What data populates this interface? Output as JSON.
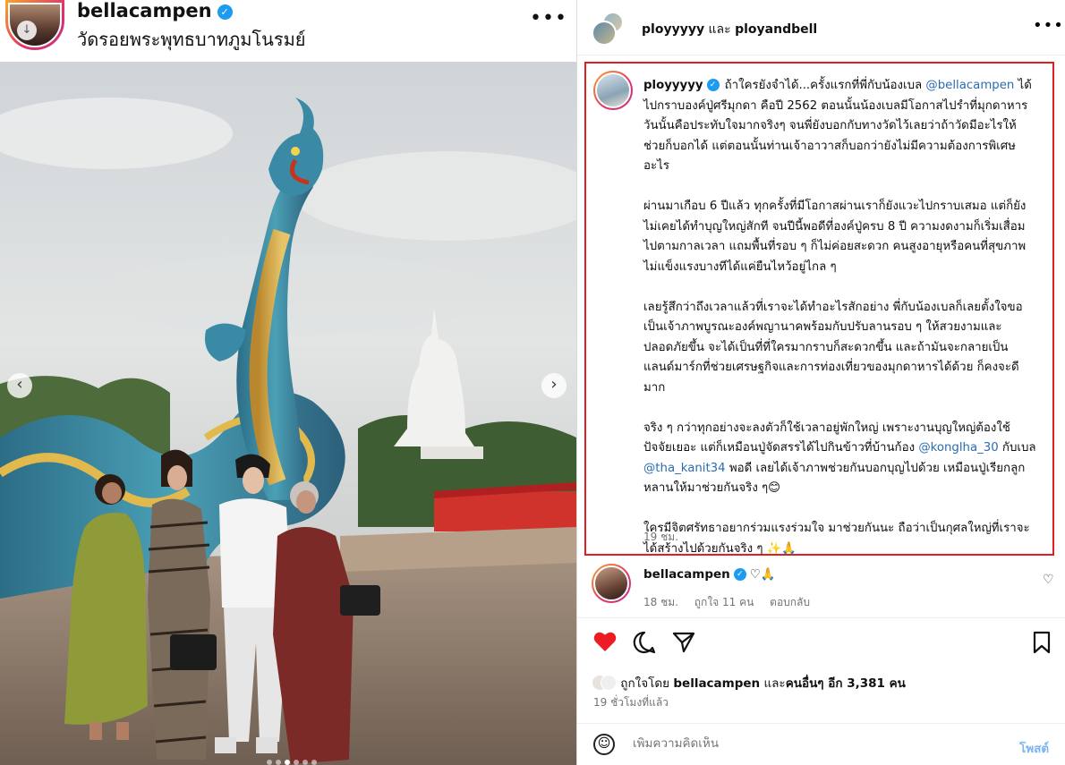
{
  "left": {
    "username": "bellacampen",
    "location": "วัดรอยพระพุทธบาทภูมโนรมย์",
    "more_icon": "more-horizontal-icon",
    "carousel": {
      "prev_icon": "chevron-left-icon",
      "next_icon": "chevron-right-icon",
      "dots": 6,
      "active_dot": 3
    }
  },
  "right": {
    "header": {
      "user1": "ployyyyy",
      "connector": "และ",
      "user2": "ployandbell"
    },
    "caption": {
      "username": "ployyyyy",
      "para1_before": "ถ้าใครยังจำได้...ครั้งแรกที่พี่กับน้องเบล ",
      "para1_mention": "@bellacampen",
      "para1_after": " ได้ไปกราบองค์ปู่ศรีมุกดา คือปี 2562 ตอนนั้นน้องเบลมีโอกาสไปรำที่มุกดาหาร วันนั้นคือประทับใจมากจริงๆ จนพี่ยังบอกกับทางวัดไว้เลยว่าถ้าวัดมีอะไรให้ช่วยก็บอกได้ แต่ตอนนั้นท่านเจ้าอาวาสก็บอกว่ายังไม่มีความต้องการพิเศษอะไร",
      "para2": "ผ่านมาเกือบ 6 ปีแล้ว ทุกครั้งที่มีโอกาสผ่านเราก็ยังแวะไปกราบเสมอ แต่ก็ยังไม่เคยได้ทำบุญใหญ่สักที จนปีนี้พอดีที่องค์ปู่ครบ 8 ปี ความงดงามก็เริ่มเสื่อมไปตามกาลเวลา แถมพื้นที่รอบ ๆ ก็ไม่ค่อยสะดวก คนสูงอายุหรือคนที่สุขภาพไม่แข็งแรงบางทีได้แค่ยืนไหว้อยู่ไกล ๆ",
      "para3": "เลยรู้สึกว่าถึงเวลาแล้วที่เราจะได้ทำอะไรสักอย่าง พี่กับน้องเบลก็เลยตั้งใจขอเป็นเจ้าภาพบูรณะองค์พญานาคพร้อมกับปรับลานรอบ ๆ ให้สวยงามและปลอดภัยขึ้น จะได้เป็นที่ที่ใครมากราบก็สะดวกขึ้น และถ้ามันจะกลายเป็นแลนด์มาร์กที่ช่วยเศรษฐกิจและการท่องเที่ยวของมุกดาหารได้ด้วย ก็คงจะดีมาก",
      "para4_a": "จริง ๆ กว่าทุกอย่างจะลงตัวก็ใช้เวลาอยู่พักใหญ่ เพราะงานบุญใหญ่ต้องใช้ปัจจัยเยอะ แต่ก็เหมือนปู่จัดสรรได้ไปกินข้าวที่บ้านก้อง ",
      "para4_m1": "@konglha_30",
      "para4_b": " กับเบล ",
      "para4_m2": "@tha_kanit34",
      "para4_c": " พอดี เลยได้เจ้าภาพช่วยกันบอกบุญไปด้วย เหมือนปู่เรียกลูกหลานให้มาช่วยกันจริง ๆ😊",
      "para5": "ใครมีจิตศรัทธาอยากร่วมแรงร่วมใจ มาช่วยกันนะ ถือว่าเป็นกุศลใหญ่ที่เราจะได้สร้างไปด้วยกันจริง ๆ ✨🙏",
      "time": "19 ชม."
    },
    "comment": {
      "username": "bellacampen",
      "text": "♡🙏",
      "time": "18 ชม.",
      "likes": "ถูกใจ 11 คน",
      "reply": "ตอบกลับ",
      "heart_icon": "heart-outline-icon"
    },
    "actions": {
      "like_icon": "heart-filled-icon",
      "comment_icon": "comment-icon",
      "share_icon": "share-icon",
      "save_icon": "bookmark-icon"
    },
    "likes": {
      "prefix": "ถูกใจโดย ",
      "by": "bellacampen",
      "middle": " และ",
      "others": "คนอื่นๆ อีก 3,381 คน"
    },
    "posted_ago": "19 ชั่วโมงที่แล้ว",
    "add_comment": {
      "placeholder": "เพิ่มความคิดเห็น",
      "post_label": "โพสต์",
      "emoji_icon": "emoji-icon"
    }
  },
  "colors": {
    "like_red": "#ed1c24",
    "mention_blue": "#2b6cb0",
    "highlight_border": "#e02020",
    "verified_blue": "#1d9bf0"
  }
}
